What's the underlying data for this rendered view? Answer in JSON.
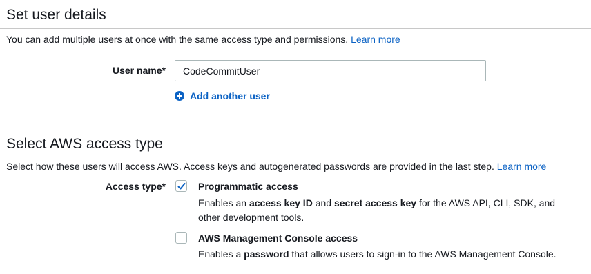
{
  "user_details": {
    "title": "Set user details",
    "description": "You can add multiple users at once with the same access type and permissions.",
    "learn_more": "Learn more",
    "user_name_label": "User name*",
    "user_name_value": "CodeCommitUser",
    "add_another_user": "Add another user"
  },
  "access_type": {
    "title": "Select AWS access type",
    "description": "Select how these users will access AWS. Access keys and autogenerated passwords are provided in the last step.",
    "learn_more": "Learn more",
    "label": "Access type*",
    "options": [
      {
        "title": "Programmatic access",
        "checked": true,
        "desc_1": "Enables an ",
        "desc_b1": "access key ID",
        "desc_2": " and ",
        "desc_b2": "secret access key",
        "desc_3": " for the AWS API, CLI, SDK, and other development tools."
      },
      {
        "title": "AWS Management Console access",
        "checked": false,
        "desc_1": "Enables a ",
        "desc_b1": "password",
        "desc_2": " that allows users to sign-in to the AWS Management Console."
      }
    ]
  },
  "colors": {
    "link": "#0b62c4",
    "text": "#16191f",
    "border": "#aab7b8"
  }
}
